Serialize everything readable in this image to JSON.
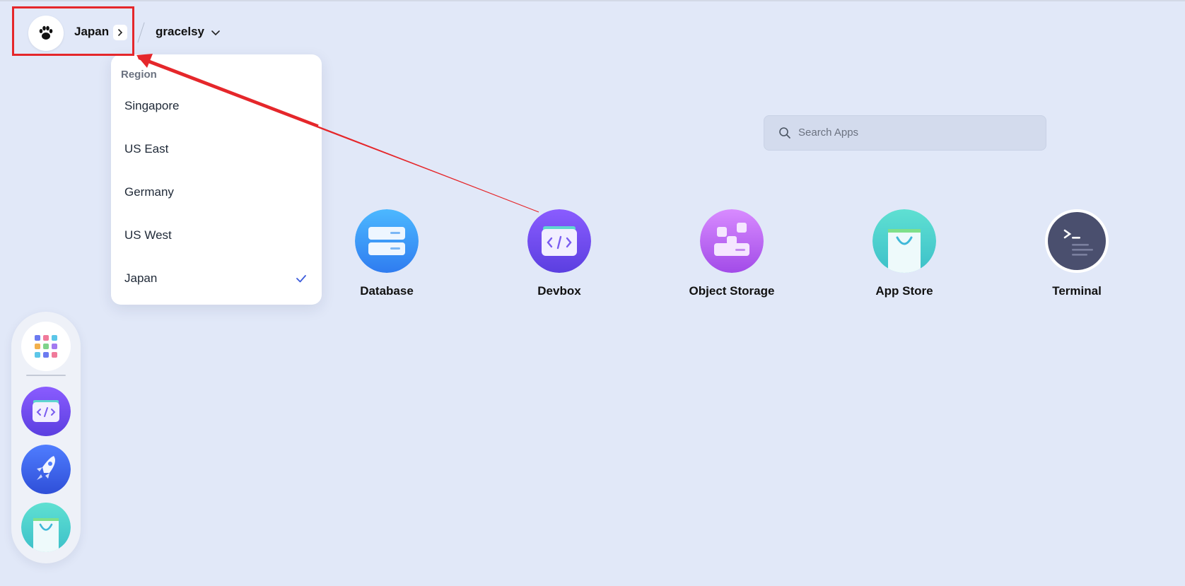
{
  "header": {
    "region": "Japan",
    "workspace": "gracelsy"
  },
  "dropdown": {
    "heading": "Region",
    "items": [
      {
        "label": "Singapore",
        "selected": false
      },
      {
        "label": "US East",
        "selected": false
      },
      {
        "label": "Germany",
        "selected": false
      },
      {
        "label": "US West",
        "selected": false
      },
      {
        "label": "Japan",
        "selected": true
      }
    ]
  },
  "search": {
    "placeholder": "Search Apps",
    "icon": "search-icon"
  },
  "apps": [
    {
      "label": "Database",
      "icon": "database-icon"
    },
    {
      "label": "Devbox",
      "icon": "devbox-icon"
    },
    {
      "label": "Object Storage",
      "icon": "object-storage-icon"
    },
    {
      "label": "App Store",
      "icon": "app-store-icon"
    },
    {
      "label": "Terminal",
      "icon": "terminal-icon"
    }
  ],
  "dock": {
    "items": [
      {
        "icon": "apps-grid-icon"
      },
      {
        "icon": "devbox-icon"
      },
      {
        "icon": "rocket-icon"
      },
      {
        "icon": "app-store-icon"
      }
    ]
  },
  "colors": {
    "background": "#e1e8f8",
    "annotation": "#e5272b",
    "check": "#3b5bdb"
  }
}
